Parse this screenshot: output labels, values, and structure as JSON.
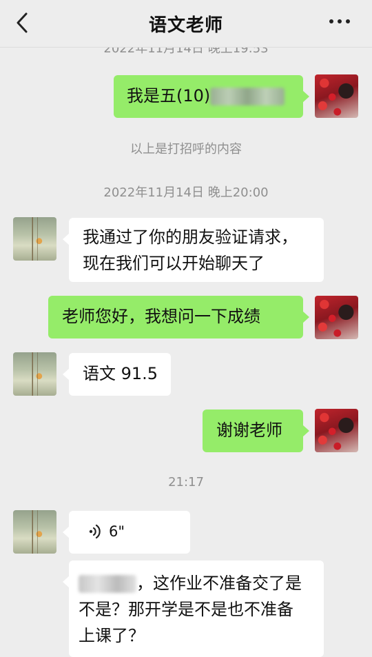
{
  "header": {
    "title": "语文老师",
    "back_icon": "chevron-left-icon",
    "more_icon": "more-horizontal-icon"
  },
  "timestamps": {
    "partial_top": "2022年11月14日 晚上19:53",
    "second": "2022年11月14日 晚上20:00",
    "third": "21:17"
  },
  "system_note": "以上是打招呼的内容",
  "messages": [
    {
      "side": "right",
      "text": "我是五(10)",
      "redacted": true
    },
    {
      "side": "left",
      "line1": "我通过了你的朋友验证请求，",
      "line2": "现在我们可以开始聊天了"
    },
    {
      "side": "right",
      "text": "老师您好，我想问一下成绩"
    },
    {
      "side": "left",
      "text": "语文 91.5"
    },
    {
      "side": "right",
      "text": "谢谢老师"
    },
    {
      "side": "left",
      "type": "voice",
      "duration": "6\""
    },
    {
      "side": "left",
      "text_after_blur": "，这作业不准备交了是",
      "line2": "不是？那开学是不是也不准备",
      "line3": "上课了？"
    }
  ],
  "colors": {
    "background": "#ededed",
    "sent_bubble": "#95ec69",
    "received_bubble": "#ffffff",
    "timestamp_text": "#8f8f8f"
  }
}
